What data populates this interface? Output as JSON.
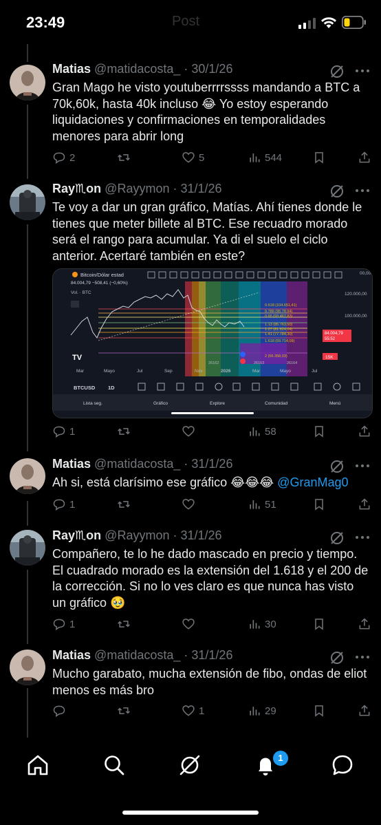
{
  "status_bar": {
    "time": "23:49",
    "faint_title": "Post"
  },
  "tweets": [
    {
      "name": "Matias",
      "handle": "@matidacosta_",
      "date": "· 30/1/26",
      "text": "Gran Mago he visto youtuberrrrssss mandando a BTC a 70k,60k, hasta 40k incluso 😂 Yo estoy esperando liquidaciones y confirmaciones en temporalidades menores para abrir long",
      "replies": "2",
      "reposts": "",
      "likes": "5",
      "views": "544"
    },
    {
      "name": "Ray♏on",
      "handle": "@Rayymon",
      "date": "· 31/1/26",
      "text": "Te voy a dar un gran gráfico, Matías. Ahí tienes donde le tienes que meter billete al BTC. Ese recuadro morado será el rango para acumular. Ya di el suelo el ciclo anterior. Acertaré también en este?",
      "replies": "1",
      "reposts": "",
      "likes": "",
      "views": "58"
    },
    {
      "name": "Matias",
      "handle": "@matidacosta_",
      "date": "· 31/1/26",
      "text": "Ah si, está clarísimo ese gráfico 😂😂😂 ",
      "mention": "@GranMag0",
      "replies": "1",
      "reposts": "",
      "likes": "",
      "views": "51"
    },
    {
      "name": "Ray♏on",
      "handle": "@Rayymon",
      "date": "· 31/1/26",
      "text": "Compañero, te lo he dado mascado en precio y tiempo. El cuadrado morado es la extensión del 1.618 y el 200 de la corrección. Si no lo ves claro es que nunca has visto un gráfico 🥹",
      "replies": "1",
      "reposts": "",
      "likes": "",
      "views": "30"
    },
    {
      "name": "Matias",
      "handle": "@matidacosta_",
      "date": "· 31/1/26",
      "text": "Mucho garabato, mucha extensión de fibo, ondas de eliot menos es más bro",
      "replies": "",
      "reposts": "",
      "likes": "1",
      "views": "29"
    }
  ],
  "embedded_chart": {
    "title": "Bitcoin/Dólar estad",
    "price_line": "84.004,79  −508,41 (−0,60%)",
    "vol_label": "Vol. · BTC",
    "top_price": "120.000,00",
    "mid_price": "100.000,00",
    "last_price": "84.004,79",
    "last_time": "55:52",
    "corner_price": "00,00",
    "fib_labels": [
      "0.618 (104.651,41)",
      "0.786 (95.78.94)",
      "0.65 (93.467,83)",
      "1.13 (85.763,50)",
      "1.27 (81.824,04)",
      "1.41 (77.784,30)",
      "1.618 (59.714,09)",
      "2 (56.358,03)"
    ],
    "bottom_labels": [
      "26162",
      "26163",
      "26164"
    ],
    "interval_badge": "15K",
    "x_labels": [
      "Mar",
      "Mayo",
      "Jul",
      "Sep",
      "Nov",
      "2026",
      "Mar",
      "Mayo",
      "Jul"
    ],
    "symbol": "BTCUSD",
    "timeframe": "1D",
    "nav": [
      "Lista seg.",
      "Gráfico",
      "Explore",
      "Comunidad",
      "Menú"
    ]
  },
  "tabbar": {
    "notifications_badge": "1"
  }
}
